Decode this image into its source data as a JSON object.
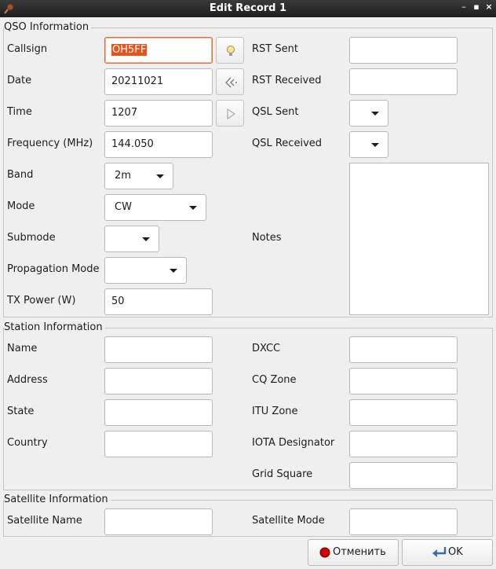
{
  "window": {
    "title": "Edit Record 1"
  },
  "window_controls": {
    "minimize": "–",
    "maximize": "▪",
    "close": "×"
  },
  "qso": {
    "legend": "QSO Information",
    "callsign_label": "Callsign",
    "callsign_value": "OH5FF",
    "date_label": "Date",
    "date_value": "20211021",
    "time_label": "Time",
    "time_value": "1207",
    "frequency_label": "Frequency (MHz)",
    "frequency_value": "144.050",
    "band_label": "Band",
    "band_value": "2m",
    "mode_label": "Mode",
    "mode_value": "CW",
    "submode_label": "Submode",
    "submode_value": "",
    "propagation_label": "Propagation Mode",
    "propagation_value": "",
    "txpower_label": "TX Power (W)",
    "txpower_value": "50",
    "rst_sent_label": "RST Sent",
    "rst_sent_value": "",
    "rst_received_label": "RST Received",
    "rst_received_value": "",
    "qsl_sent_label": "QSL Sent",
    "qsl_sent_value": "",
    "qsl_received_label": "QSL Received",
    "qsl_received_value": "",
    "notes_label": "Notes",
    "notes_value": ""
  },
  "station": {
    "legend": "Station Information",
    "name_label": "Name",
    "name_value": "",
    "address_label": "Address",
    "address_value": "",
    "state_label": "State",
    "state_value": "",
    "country_label": "Country",
    "country_value": "",
    "dxcc_label": "DXCC",
    "dxcc_value": "",
    "cq_zone_label": "CQ Zone",
    "cq_zone_value": "",
    "itu_zone_label": "ITU Zone",
    "itu_zone_value": "",
    "iota_label": "IOTA Designator",
    "iota_value": "",
    "grid_label": "Grid Square",
    "grid_value": ""
  },
  "satellite": {
    "legend": "Satellite Information",
    "name_label": "Satellite Name",
    "name_value": "",
    "mode_label": "Satellite Mode",
    "mode_value": ""
  },
  "buttons": {
    "cancel": "Отменить",
    "ok": "OK"
  },
  "colors": {
    "selection": "#e8521a",
    "focus_border": "#e0703f",
    "cancel_icon": "#d00000",
    "ok_icon": "#3a6ea5"
  },
  "icons": {
    "lookup": "lightbulb-icon",
    "date_now": "back-arrow-icon",
    "time_now": "play-icon",
    "cancel": "stop-circle-icon",
    "ok": "enter-arrow-icon"
  }
}
